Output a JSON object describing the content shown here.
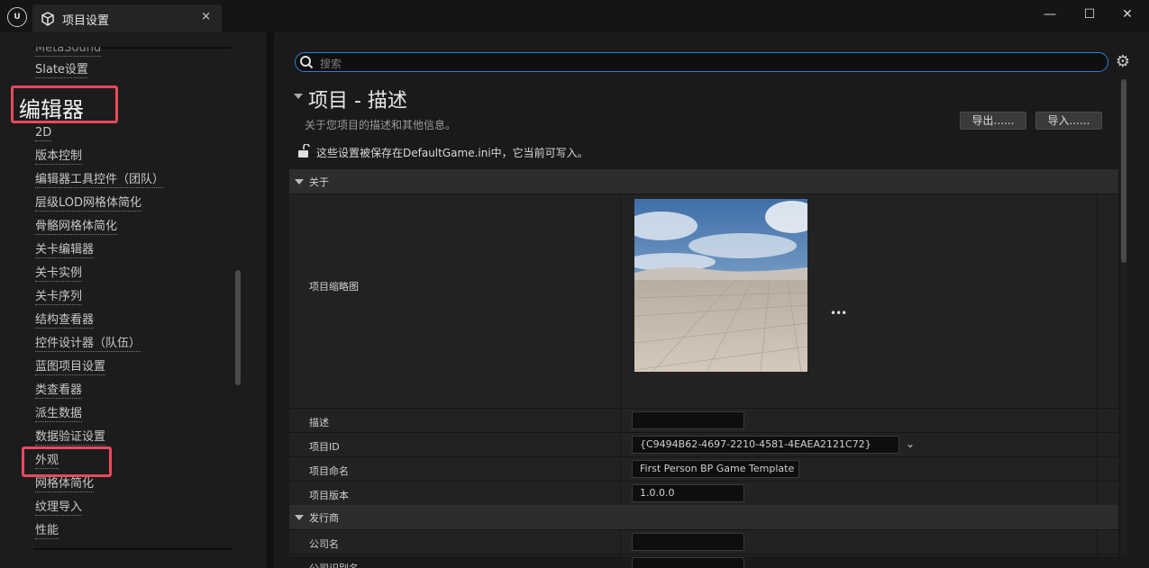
{
  "window": {
    "tab_title": "项目设置",
    "tab_close": "×",
    "minimize": "—",
    "maximize": "☐",
    "close": "✕"
  },
  "sidebar": {
    "items_top": [
      "MetaSound",
      "Slate设置"
    ],
    "header": "编辑器",
    "items": [
      "2D",
      "版本控制",
      "编辑器工具控件（团队）",
      "层级LOD网格体简化",
      "骨骼网格体简化",
      "关卡编辑器",
      "关卡实例",
      "关卡序列",
      "结构查看器",
      "控件设计器（队伍）",
      "蓝图项目设置",
      "类查看器",
      "派生数据",
      "数据验证设置",
      "外观",
      "网格体简化",
      "纹理导入",
      "性能"
    ],
    "highlighted": [
      "编辑器",
      "外观"
    ]
  },
  "search": {
    "placeholder": "搜索"
  },
  "header": {
    "title": "项目 - 描述",
    "subtitle": "关于您项目的描述和其他信息。",
    "export_label": "导出......",
    "import_label": "导入......",
    "save_note": "这些设置被保存在DefaultGame.ini中，它当前可写入。"
  },
  "sections": {
    "about": {
      "label": "关于",
      "thumbnail_label": "项目缩略图",
      "description_label": "描述",
      "description_value": "",
      "project_id_label": "项目ID",
      "project_id_value": "{C9494B62-4697-2210-4581-4EAEA2121C72}",
      "project_name_label": "项目命名",
      "project_name_value": "First Person BP Game Template",
      "project_version_label": "项目版本",
      "project_version_value": "1.0.0.0"
    },
    "publisher": {
      "label": "发行商",
      "company_label": "公司名",
      "company_value": "",
      "company_id_label": "公司识别名",
      "company_id_value": ""
    }
  },
  "icons": {
    "logo": "unreal-logo-icon",
    "settings": "gear-icon",
    "search": "search-icon",
    "lock": "unlocked-icon"
  },
  "colors": {
    "highlight": "#e84a5f",
    "search_border": "#2d7fd8"
  }
}
